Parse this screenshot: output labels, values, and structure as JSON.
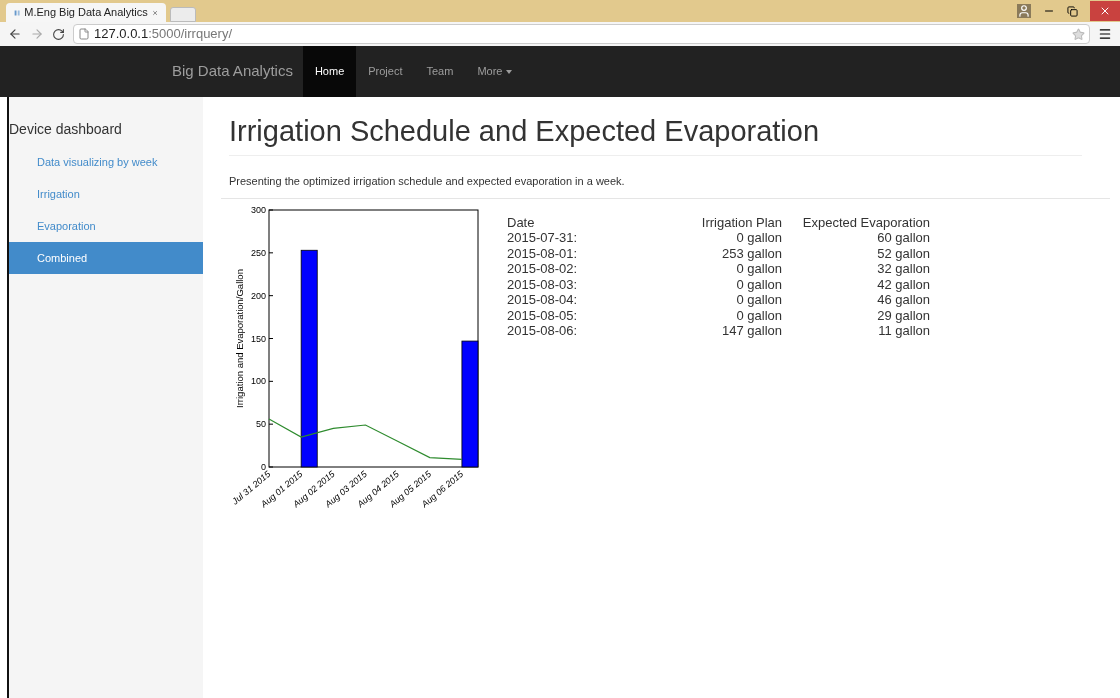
{
  "browser": {
    "tab_title": "M.Eng Big Data Analytics",
    "url_host": "127.0.0.1",
    "url_path": ":5000/irrquery/"
  },
  "navbar": {
    "brand": "Big Data Analytics",
    "items": [
      {
        "label": "Home",
        "selected": true,
        "kind": "link"
      },
      {
        "label": "Project",
        "selected": false,
        "kind": "link"
      },
      {
        "label": "Team",
        "selected": false,
        "kind": "link"
      },
      {
        "label": "More",
        "selected": false,
        "kind": "dropdown"
      }
    ]
  },
  "sidebar": {
    "title": "Device dashboard",
    "items": [
      {
        "label": "Data visualizing by week",
        "selected": false
      },
      {
        "label": "Irrigation",
        "selected": false
      },
      {
        "label": "Evaporation",
        "selected": false
      },
      {
        "label": "Combined",
        "selected": true
      }
    ]
  },
  "main": {
    "title": "Irrigation Schedule and Expected Evaporation",
    "description": "Presenting the optimized irrigation schedule and expected evaporation in a week.",
    "chart_data": {
      "type": "bar",
      "ylabel": "Irrigation and Evaporation/Gallon",
      "categories": [
        "Jul 31 2015",
        "Aug 01 2015",
        "Aug 02 2015",
        "Aug 03 2015",
        "Aug 04 2015",
        "Aug 05 2015",
        "Aug 06 2015"
      ],
      "ylim": [
        0,
        300
      ],
      "yticks": [
        0,
        50,
        100,
        150,
        200,
        250,
        300
      ],
      "series": [
        {
          "color": "#0000ff",
          "values": [
            0,
            253,
            0,
            0,
            0,
            0,
            147
          ]
        },
        {
          "type": "line",
          "color": "#2e8b2e",
          "values": [
            56,
            35,
            45,
            49,
            30,
            11,
            9
          ]
        }
      ]
    },
    "table": {
      "columns": [
        "Date",
        "Irrigation Plan",
        "Expected Evaporation"
      ],
      "rows": [
        [
          "2015-07-31:",
          "0 gallon",
          "60 gallon"
        ],
        [
          "2015-08-01:",
          "253 gallon",
          "52 gallon"
        ],
        [
          "2015-08-02:",
          "0 gallon",
          "32 gallon"
        ],
        [
          "2015-08-03:",
          "0 gallon",
          "42 gallon"
        ],
        [
          "2015-08-04:",
          "0 gallon",
          "46 gallon"
        ],
        [
          "2015-08-05:",
          "0 gallon",
          "29 gallon"
        ],
        [
          "2015-08-06:",
          "147 gallon",
          "11 gallon"
        ]
      ]
    }
  }
}
